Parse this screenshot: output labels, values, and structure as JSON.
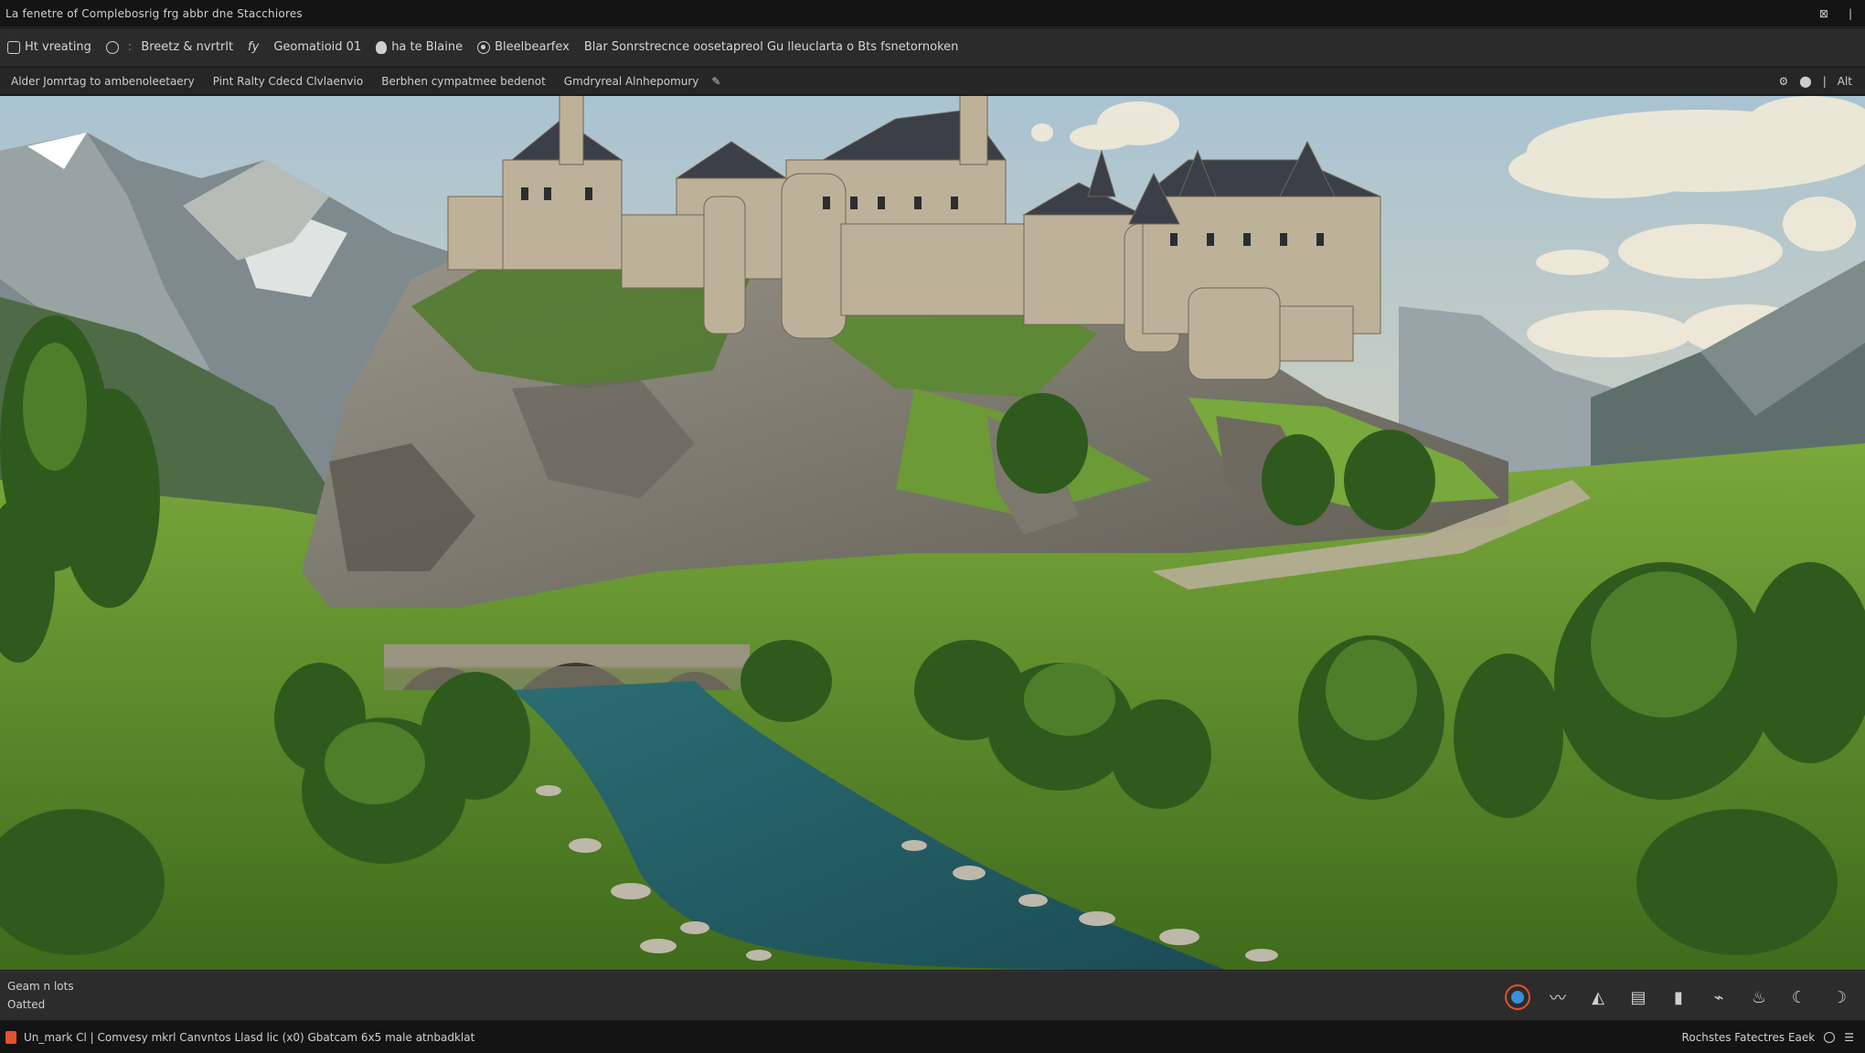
{
  "window": {
    "title": "La fenetre of Complebosrig frg abbr dne Stacchiores",
    "controls": [
      "⊠",
      "|"
    ]
  },
  "toolbar": {
    "items": [
      {
        "icon": "window-icon",
        "label": "Ht vreating"
      },
      {
        "icon": "square-icon",
        "label": "Breetz & nvrtrlt"
      },
      {
        "icon": "fx-icon",
        "label": "fy"
      },
      {
        "icon": "none",
        "label": "Geomatioid 01"
      },
      {
        "icon": "apple-icon",
        "label": "ha te Blaine"
      },
      {
        "icon": "target-icon",
        "label": "Bleelbearfex"
      },
      {
        "icon": "none",
        "label": "Blar Sonrstrecnce oosetapreol Gu lleuclarta o Bts fsnetornoken"
      }
    ]
  },
  "subtoolbar": {
    "items": [
      "Alder Jomrtag to ambenoleetaery",
      "Pint Ralty Cdecd Clvlaenvio",
      "Berbhen cympatmee bedenot",
      "Gmdryreal Alnhepomury"
    ],
    "edit_icon": "pencil-icon",
    "right": [
      "⚙",
      "⬤",
      "|",
      "Alt"
    ]
  },
  "viewport": {
    "image": "castle-landscape",
    "colors": {
      "sky": "#b9c8cf",
      "grass": "#6f9a33",
      "rock": "#8f8a7d",
      "river": "#2f6b6e",
      "castle": "#bdb19a"
    }
  },
  "statusbar": {
    "line1": "Geam n lots",
    "line2": "Oatted",
    "icons": [
      "globe-icon",
      "wave-icon",
      "compass-icon",
      "stack-icon",
      "bar-icon",
      "bird-icon",
      "flame-icon",
      "moon-icon",
      "moon-outline-icon"
    ]
  },
  "bottombar": {
    "text": "Un_mark Cl | Comvesy mkrl Canvntos Llasd lic (x0) Gbatcam 6x5 male atnbadklat",
    "right_text": "Rochstes Fatectres Eaek"
  }
}
